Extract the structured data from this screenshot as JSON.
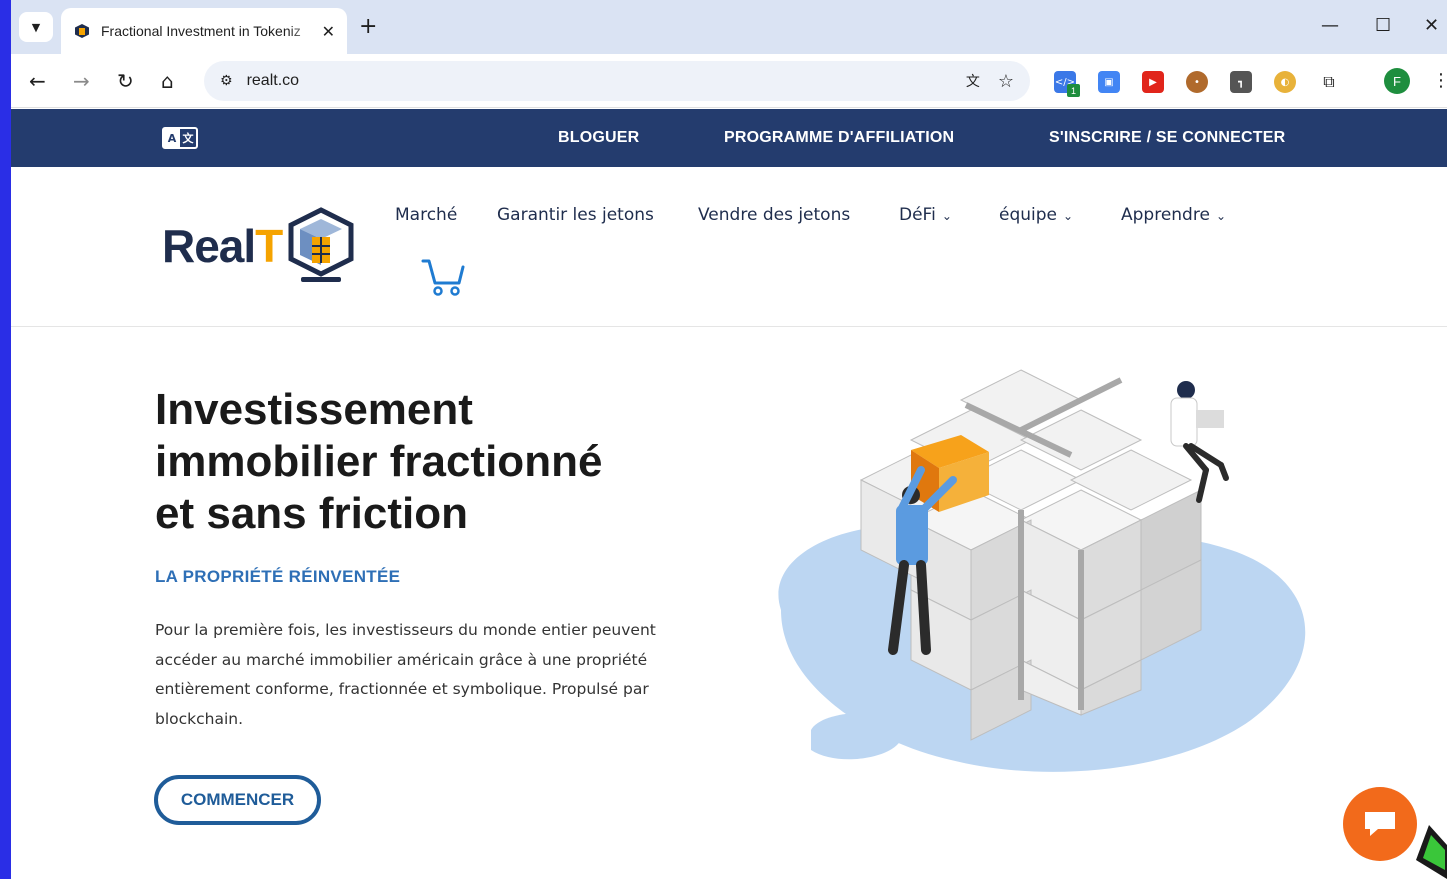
{
  "browser": {
    "tab_title": "Fractional Investment in Tokeniz",
    "url": "realt.co",
    "profile_initial": "F",
    "extension_badge": "1"
  },
  "site": {
    "topbar": {
      "blog": "BLOGUER",
      "affiliate": "PROGRAMME D'AFFILIATION",
      "signin": "S'INSCRIRE / SE CONNECTER",
      "translate_a": "A",
      "translate_b": "文"
    },
    "logo": {
      "text_main": "Real",
      "text_accent": "T"
    },
    "menu": [
      {
        "label": "Marché"
      },
      {
        "label": "Garantir les jetons"
      },
      {
        "label": "Vendre des jetons"
      },
      {
        "label": "DéFi"
      },
      {
        "label": "équipe"
      },
      {
        "label": "Apprendre"
      }
    ],
    "hero": {
      "title_line1": "Investissement",
      "title_line2": "immobilier fractionné",
      "title_line3": "et sans friction",
      "subtitle": "LA PROPRIÉTÉ RÉINVENTÉE",
      "description": "Pour la première fois, les investisseurs du monde entier peuvent accéder au marché immobilier américain grâce à une propriété entièrement conforme, fractionnée et symbolique. Propulsé par blockchain.",
      "cta": "COMMENCER"
    }
  },
  "colors": {
    "navy": "#243c6e",
    "accent_orange": "#f5a300",
    "blue_text": "#2e6fb6",
    "chat_orange": "#f26a1b"
  }
}
